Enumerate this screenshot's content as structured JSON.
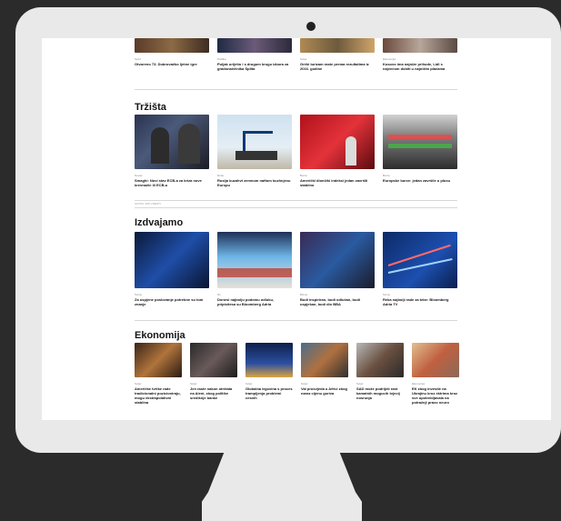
{
  "colors": {
    "bezel": "#e9e9e9",
    "background": "#2b2b2b",
    "screen": "#ffffff"
  },
  "row0": [
    {
      "tag": "Sport",
      "caption": "Otvoreno 73. Dubrovačko ljetne igre"
    },
    {
      "tag": "Politika",
      "caption": "Puljak urijetio i s drugom krugu izbora za gradonačelnika Splita"
    },
    {
      "tag": "Svijet",
      "caption": "Grčki turizam raste prema rezultatima iz 2016. godine"
    },
    {
      "tag": "Ekonomija",
      "caption": "Kosovo ima najniže prihode, Lidl s najvećom dobiti u najnižim plaćama"
    }
  ],
  "sections": {
    "trzista": {
      "title": "Tržišta",
      "items": [
        {
          "tag": "Novac",
          "caption": "Smaghi: Novi stav ECB-a za kriza nove krevnačić ili ECB-u"
        },
        {
          "tag": "Robe",
          "caption": "Rusija kuzahvt zemnom naftom kuzhnjevu Europu"
        },
        {
          "tag": "Burze",
          "caption": "Američki dionički indeksi jedan završili stabilno"
        },
        {
          "tag": "Burze",
          "caption": "Europske burze: jedan završile u plusu"
        }
      ],
      "note": "UCITAJ JOS VIJESTI"
    },
    "izdvajamo": {
      "title": "Izdvajamo",
      "items": [
        {
          "tag": "Tehno",
          "caption": "Za uspjene poslovanje potrebne su tom znanje"
        },
        {
          "tag": "N1",
          "caption": "Donesi najbolju podomu odluku, pripisitesa su Bloomberg Adria"
        },
        {
          "tag": "Biznis",
          "caption": "Budi inspiriran, budi odlučan, budi uspješan, budi dio BBA"
        },
        {
          "tag": "Tehno",
          "caption": "Reka najbolji rade za tebe: Bloomberg Adria TV"
        }
      ]
    },
    "ekonomija": {
      "title": "Ekonomija",
      "items": [
        {
          "tag": "Svijet",
          "caption": "Američke tvrtke rade tradicionalni pozicioniraju, mogu ekstrapolativni stabilna"
        },
        {
          "tag": "Svijet",
          "caption": "Jen raste nakon otretata na Aleni, zbog politike središnje banke"
        },
        {
          "tag": "Svijet",
          "caption": "Globalna trgovina s proces trampljenja problemi cesnih"
        },
        {
          "tag": "Svijet",
          "caption": "Val prosvjeda u Africi zbog naraz cijenu goriva"
        },
        {
          "tag": "Svijet",
          "caption": "SAD može podrijeti rast kamatnih mogucih tvjecij nosrunja"
        },
        {
          "tag": "Ekonomija",
          "caption": "EK zbog investie na Ukrajinu kroz ektrima kroz sve upotrebljavala na potražnji pravo neuro"
        }
      ]
    }
  }
}
